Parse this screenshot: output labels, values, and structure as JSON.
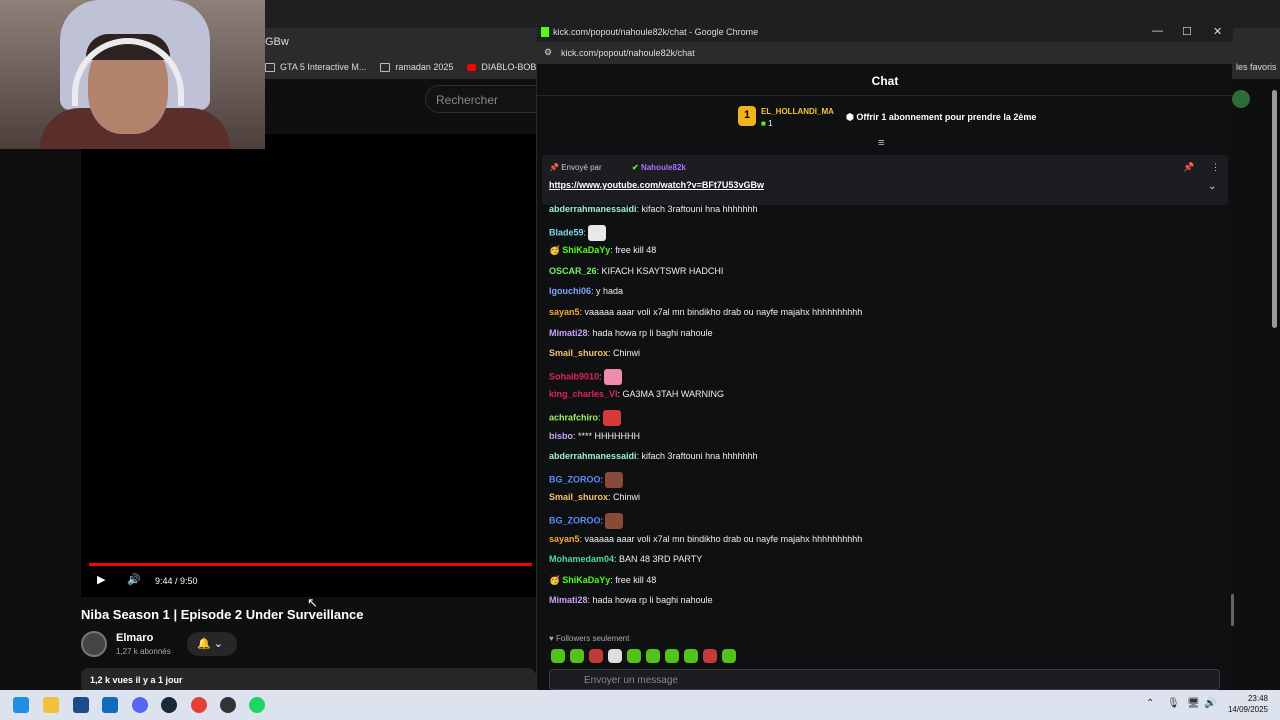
{
  "bg_browser": {
    "tab_partial": "GBw",
    "bookmarks": [
      "GTA 5 Interactive M...",
      "ramadan 2025",
      "DIABLO-BOBONY F..."
    ],
    "favoris": "les favoris",
    "search_placeholder": "Rechercher"
  },
  "video": {
    "time": "9:44 / 9:50",
    "progress_fraction": 0.99,
    "title": "Niba Season 1 | Episode 2 Under Surveillance",
    "channel": "Elmaro",
    "subscribers": "1,27 k abonnés",
    "meta": "1,2 k vues  il y a 1 jour",
    "play_icon": "▶",
    "volume_icon": "🔊",
    "bell_icon": "🔔",
    "chevron_icon": "⌄"
  },
  "popup": {
    "window_title": "kick.com/popout/nahoule82k/chat - Google Chrome",
    "url": "kick.com/popout/nahoule82k/chat",
    "minimize": "—",
    "maximize": "☐",
    "close": "✕"
  },
  "chat": {
    "header": "Chat",
    "gift": {
      "rank": "1",
      "user": "EL_HOLLANDI_MA",
      "count": "1",
      "text": "Offrir 1 abonnement pour prendre la 2ème"
    },
    "pinned": {
      "sent_by": "Envoyé par",
      "user": "Nahoule82k",
      "link": "https://www.youtube.com/watch?v=BFt7U53vGBw"
    },
    "messages": [
      {
        "user": "abderrahmanessaidi",
        "color": "#9ef0c8",
        "text": ": kifach 3raftouni hna hhhhhhh",
        "emote": ""
      },
      {
        "user": "Blade59",
        "color": "#7fd9e8",
        "text": ":",
        "emote": "#e8e8e8"
      },
      {
        "user": "ShiKaDaYy",
        "color": "#53fc18",
        "text": ": free kill 48",
        "emote": "",
        "badge": "🥳"
      },
      {
        "user": "OSCAR_26",
        "color": "#75f06b",
        "text": ": KIFACH KSAYTSWR HADCHI",
        "emote": ""
      },
      {
        "user": "lgouchi06",
        "color": "#7da6ff",
        "text": ": y hada",
        "emote": ""
      },
      {
        "user": "sayan5",
        "color": "#f2a93b",
        "text": ": vaaaaa aaar voli x7al mn bindikho drab ou nayfe majahx hhhhhhhhhh",
        "emote": ""
      },
      {
        "user": "Mimati28",
        "color": "#c8a0f5",
        "text": ": hada howa rp li baghi nahoule",
        "emote": ""
      },
      {
        "user": "Smail_shurox",
        "color": "#f2c36b",
        "text": ": Chinwi",
        "emote": ""
      },
      {
        "user": "Sohaib9010",
        "color": "#e0245e",
        "text": ":",
        "emote": "#f08bb0"
      },
      {
        "user": "king_charles_VI",
        "color": "#e0245e",
        "text": ": GA3MA 3TAH WARNING",
        "emote": ""
      },
      {
        "user": "achrafchiro",
        "color": "#9ef06b",
        "text": ":",
        "emote": "#d43c3c"
      },
      {
        "user": "bisbo",
        "color": "#c8a0f5",
        "text": ": **** HHHHHHH",
        "emote": ""
      },
      {
        "user": "abderrahmanessaidi",
        "color": "#9ef0c8",
        "text": ": kifach 3raftouni hna hhhhhhh",
        "emote": ""
      },
      {
        "user": "BG_ZOROO",
        "color": "#5a8cff",
        "text": ":",
        "emote": "#8a4a3a"
      },
      {
        "user": "Smail_shurox",
        "color": "#f2c36b",
        "text": ": Chinwi",
        "emote": ""
      },
      {
        "user": "BG_ZOROO",
        "color": "#5a8cff",
        "text": ":",
        "emote": "#8a4a3a"
      },
      {
        "user": "sayan5",
        "color": "#f2a93b",
        "text": ": vaaaaa aaar voli x7al mn bindikho drab ou nayfe majahx hhhhhhhhhh",
        "emote": ""
      },
      {
        "user": "Mohamedam04",
        "color": "#4fd99a",
        "text": ": BAN 48 3RD PARTY",
        "emote": ""
      },
      {
        "user": "ShiKaDaYy",
        "color": "#53fc18",
        "text": ": free kill 48",
        "emote": "",
        "badge": "🥳"
      },
      {
        "user": "Mimati28",
        "color": "#c8a0f5",
        "text": ": hada howa rp li baghi nahoule",
        "emote": ""
      }
    ],
    "followers_only": "Followers seulement",
    "input_placeholder": "Envoyer un message"
  },
  "taskbar": {
    "time": "23:48",
    "date": "14/09/2025"
  }
}
